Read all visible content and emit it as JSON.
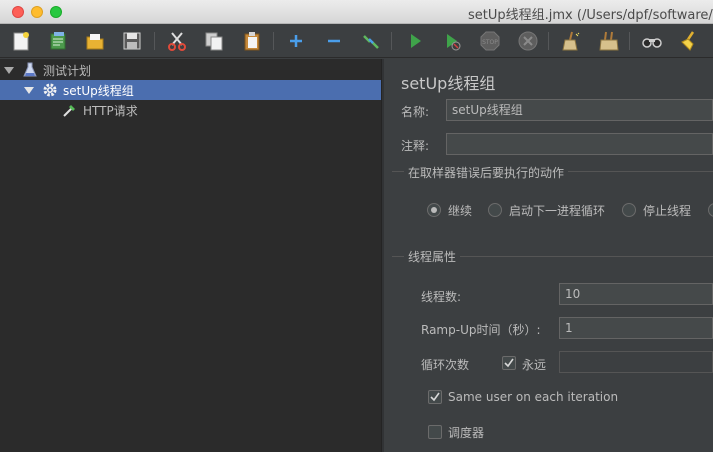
{
  "window": {
    "title": "setUp线程组.jmx (/Users/dpf/software/apa"
  },
  "toolbar": {
    "icons": [
      "new-icon",
      "templates-icon",
      "open-icon",
      "save-icon",
      "cut-icon",
      "copy-icon",
      "paste-icon",
      "expand-icon",
      "collapse-icon",
      "toggle-icon",
      "start-icon",
      "start-no-pause-icon",
      "stop-icon",
      "shutdown-icon",
      "clear-icon",
      "clear-all-icon",
      "search-icon",
      "reset-search-icon"
    ]
  },
  "tree": {
    "items": [
      {
        "label": "测试计划",
        "icon": "flask-icon"
      },
      {
        "label": "setUp线程组",
        "icon": "gear-icon",
        "selected": true
      },
      {
        "label": "HTTP请求",
        "icon": "pipette-icon"
      }
    ]
  },
  "panel": {
    "title": "setUp线程组",
    "name_label": "名称:",
    "name_value": "setUp线程组",
    "comment_label": "注释:",
    "comment_value": "",
    "error_action": {
      "legend": "在取样器错误后要执行的动作",
      "options": [
        "继续",
        "启动下一进程循环",
        "停止线程"
      ],
      "selected": "继续"
    },
    "thread_props": {
      "legend": "线程属性",
      "threads_label": "线程数:",
      "threads_value": "10",
      "rampup_label": "Ramp-Up时间（秒）:",
      "rampup_value": "1",
      "loop_label": "循环次数",
      "forever_label": "永远",
      "forever_checked": true,
      "loop_value": "",
      "same_user_label": "Same user on each iteration",
      "same_user_checked": true,
      "scheduler_label": "调度器",
      "scheduler_checked": false
    }
  }
}
